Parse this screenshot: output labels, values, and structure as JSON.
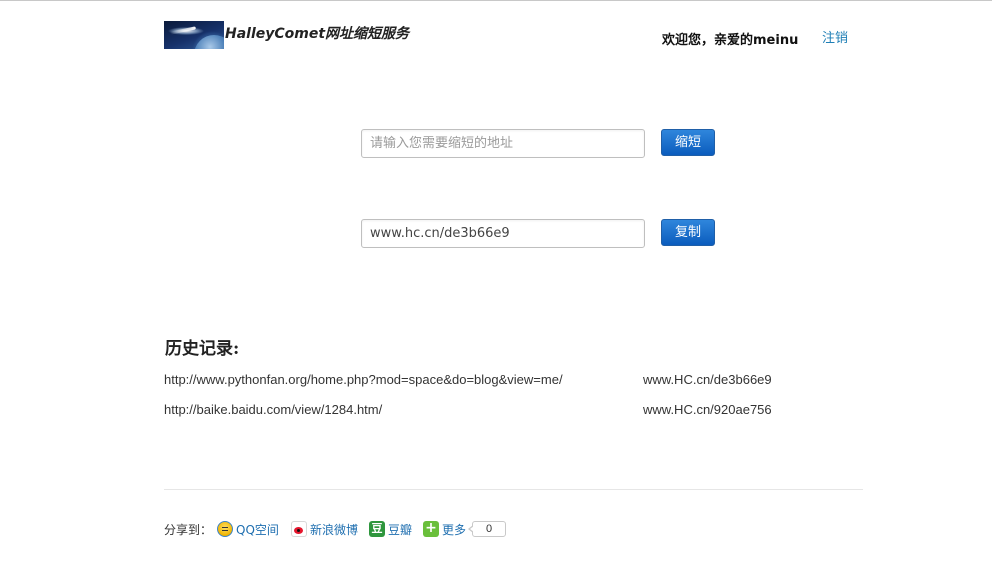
{
  "header": {
    "logo_alt": "HalleyComet logo",
    "logo_icon": "comet-earth-logo",
    "title": "HalleyComet网址缩短服务",
    "welcome_text": "欢迎您，亲爱的meinu",
    "logout_label": "注销",
    "link_color": "#1f7fb6"
  },
  "shorten_form": {
    "url_input_placeholder": "请输入您需要缩短的地址",
    "url_input_value": "",
    "shorten_button_label": "缩短",
    "result_value": "www.hc.cn/de3b66e9",
    "copy_button_label": "复制",
    "button_color": "#0b5cbd"
  },
  "history": {
    "title": "历史记录:",
    "items": [
      {
        "long_url": "http://www.pythonfan.org/home.php?mod=space&do=blog&view=me/",
        "short_url": "www.HC.cn/de3b66e9"
      },
      {
        "long_url": "http://baike.baidu.com/view/1284.htm/",
        "short_url": "www.HC.cn/920ae756"
      }
    ]
  },
  "share": {
    "label": "分享到：",
    "items": [
      {
        "icon": "qzone-icon",
        "label": "QQ空间"
      },
      {
        "icon": "sina-weibo-icon",
        "label": "新浪微博"
      },
      {
        "icon": "douban-icon",
        "label": "豆瓣"
      },
      {
        "icon": "more-plus-icon",
        "label": "更多"
      }
    ],
    "count": "0"
  }
}
